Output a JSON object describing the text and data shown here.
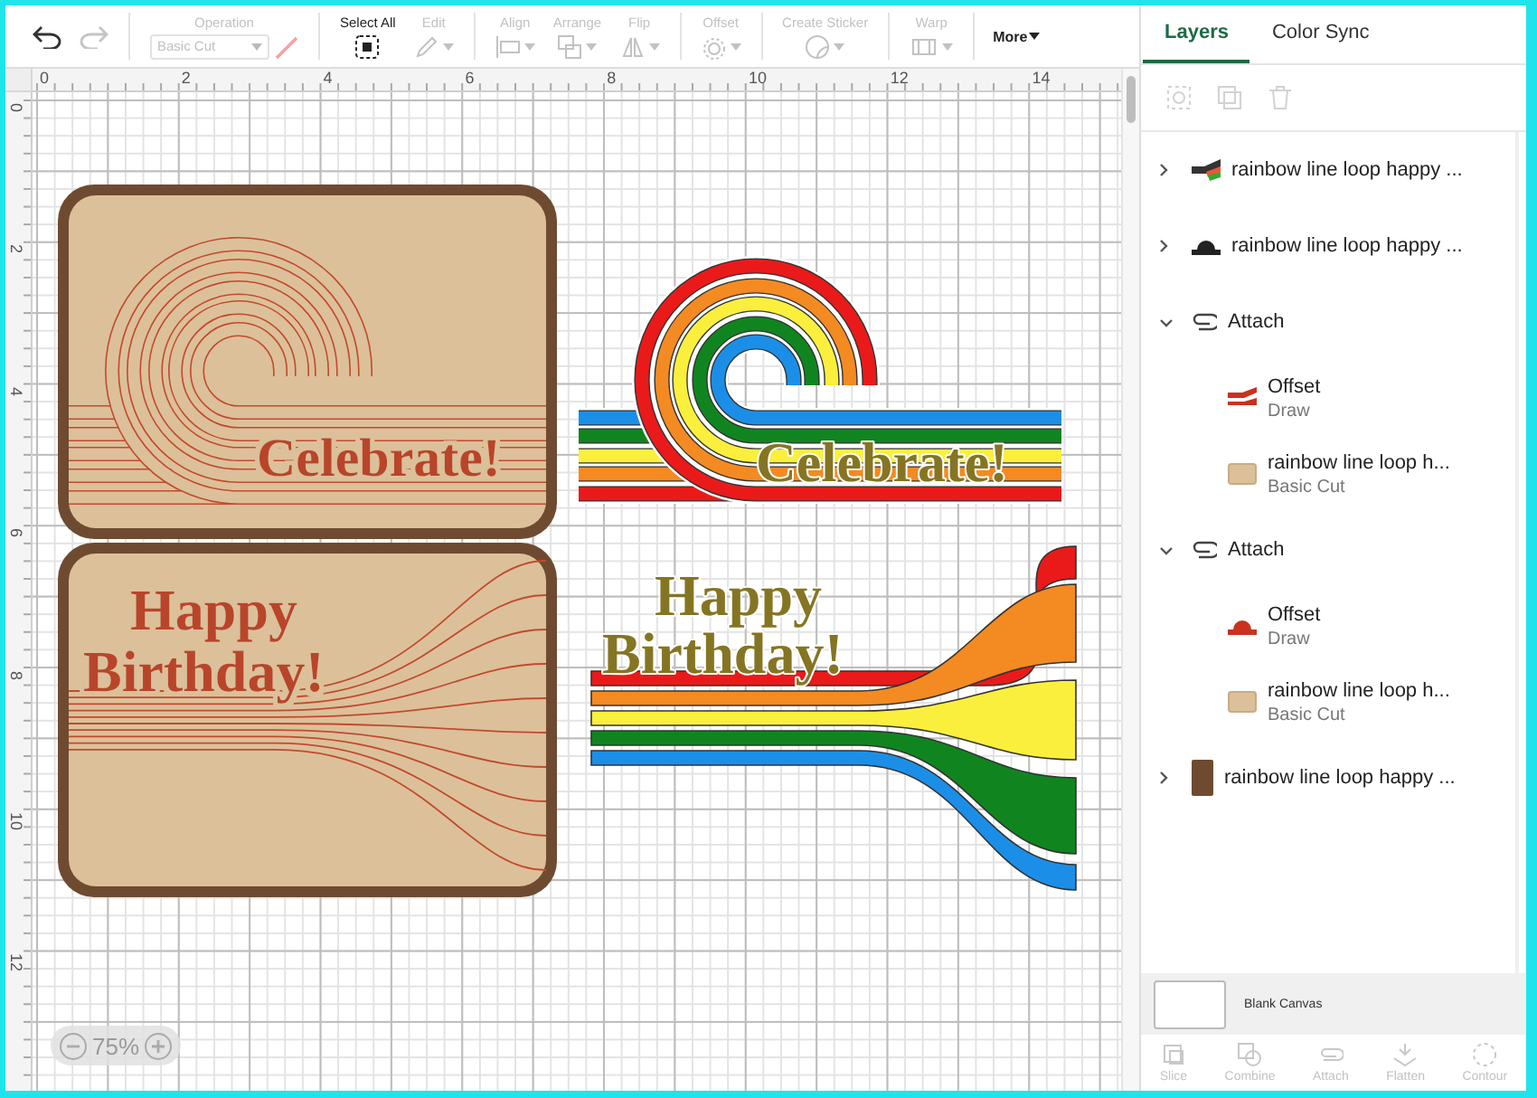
{
  "toolbar": {
    "undo": {
      "disabled": false
    },
    "redo": {
      "disabled": true
    },
    "tools": [
      {
        "kind": "select",
        "label": "Operation",
        "value": "Basic Cut",
        "disabled": true,
        "separated": true
      },
      {
        "kind": "button",
        "label": "Select All",
        "disabled": false,
        "separated": true
      },
      {
        "kind": "menu",
        "label": "Edit",
        "disabled": true,
        "separated": false
      },
      {
        "kind": "menu",
        "label": "Align",
        "disabled": true,
        "separated": true
      },
      {
        "kind": "menu",
        "label": "Arrange",
        "disabled": true,
        "separated": false
      },
      {
        "kind": "menu",
        "label": "Flip",
        "disabled": true,
        "separated": false
      },
      {
        "kind": "menu",
        "label": "Offset",
        "disabled": true,
        "separated": true
      },
      {
        "kind": "menu",
        "label": "Create Sticker",
        "disabled": true,
        "separated": true
      },
      {
        "kind": "menu",
        "label": "Warp",
        "disabled": true,
        "separated": true
      }
    ],
    "more": "More"
  },
  "canvas": {
    "rulers": {
      "horizontal": [
        "0",
        "2",
        "4",
        "6",
        "8",
        "10",
        "12",
        "14"
      ],
      "vertical": [
        "0",
        "2",
        "4",
        "6",
        "8",
        "10",
        "12"
      ]
    },
    "designs": [
      {
        "kind": "loopcard",
        "lines": [
          "Celebrate!"
        ]
      },
      {
        "kind": "fancard",
        "lines": [
          "Happy",
          "Birthday!"
        ]
      },
      {
        "kind": "loop",
        "lines": [
          "Celebrate!"
        ]
      },
      {
        "kind": "fan",
        "lines": [
          "Happy",
          "Birthday!"
        ]
      }
    ],
    "zoom": "75%"
  },
  "panel": {
    "tabs": [
      {
        "label": "Layers",
        "selected": true
      },
      {
        "label": "Color Sync",
        "selected": false
      }
    ],
    "layers": [
      {
        "kind": "group",
        "name": "rainbow line loop happy ...",
        "expanded": false
      },
      {
        "kind": "group",
        "name": "rainbow line loop happy ...",
        "expanded": false
      },
      {
        "kind": "attach",
        "name": "Attach",
        "expanded": true,
        "children": [
          {
            "name": "Offset",
            "operation": "Draw"
          },
          {
            "name": "rainbow line loop h...",
            "operation": "Basic Cut"
          }
        ]
      },
      {
        "kind": "attach",
        "name": "Attach",
        "expanded": true,
        "children": [
          {
            "name": "Offset",
            "operation": "Draw"
          },
          {
            "name": "rainbow line loop h...",
            "operation": "Basic Cut"
          }
        ]
      },
      {
        "kind": "group",
        "name": "rainbow line loop happy ...",
        "expanded": false
      }
    ],
    "canvas_label": "Blank Canvas",
    "actions": [
      {
        "label": "Slice",
        "disabled": true
      },
      {
        "label": "Combine",
        "disabled": true
      },
      {
        "label": "Attach",
        "disabled": true
      },
      {
        "label": "Flatten",
        "disabled": true
      },
      {
        "label": "Contour",
        "disabled": true
      }
    ]
  }
}
